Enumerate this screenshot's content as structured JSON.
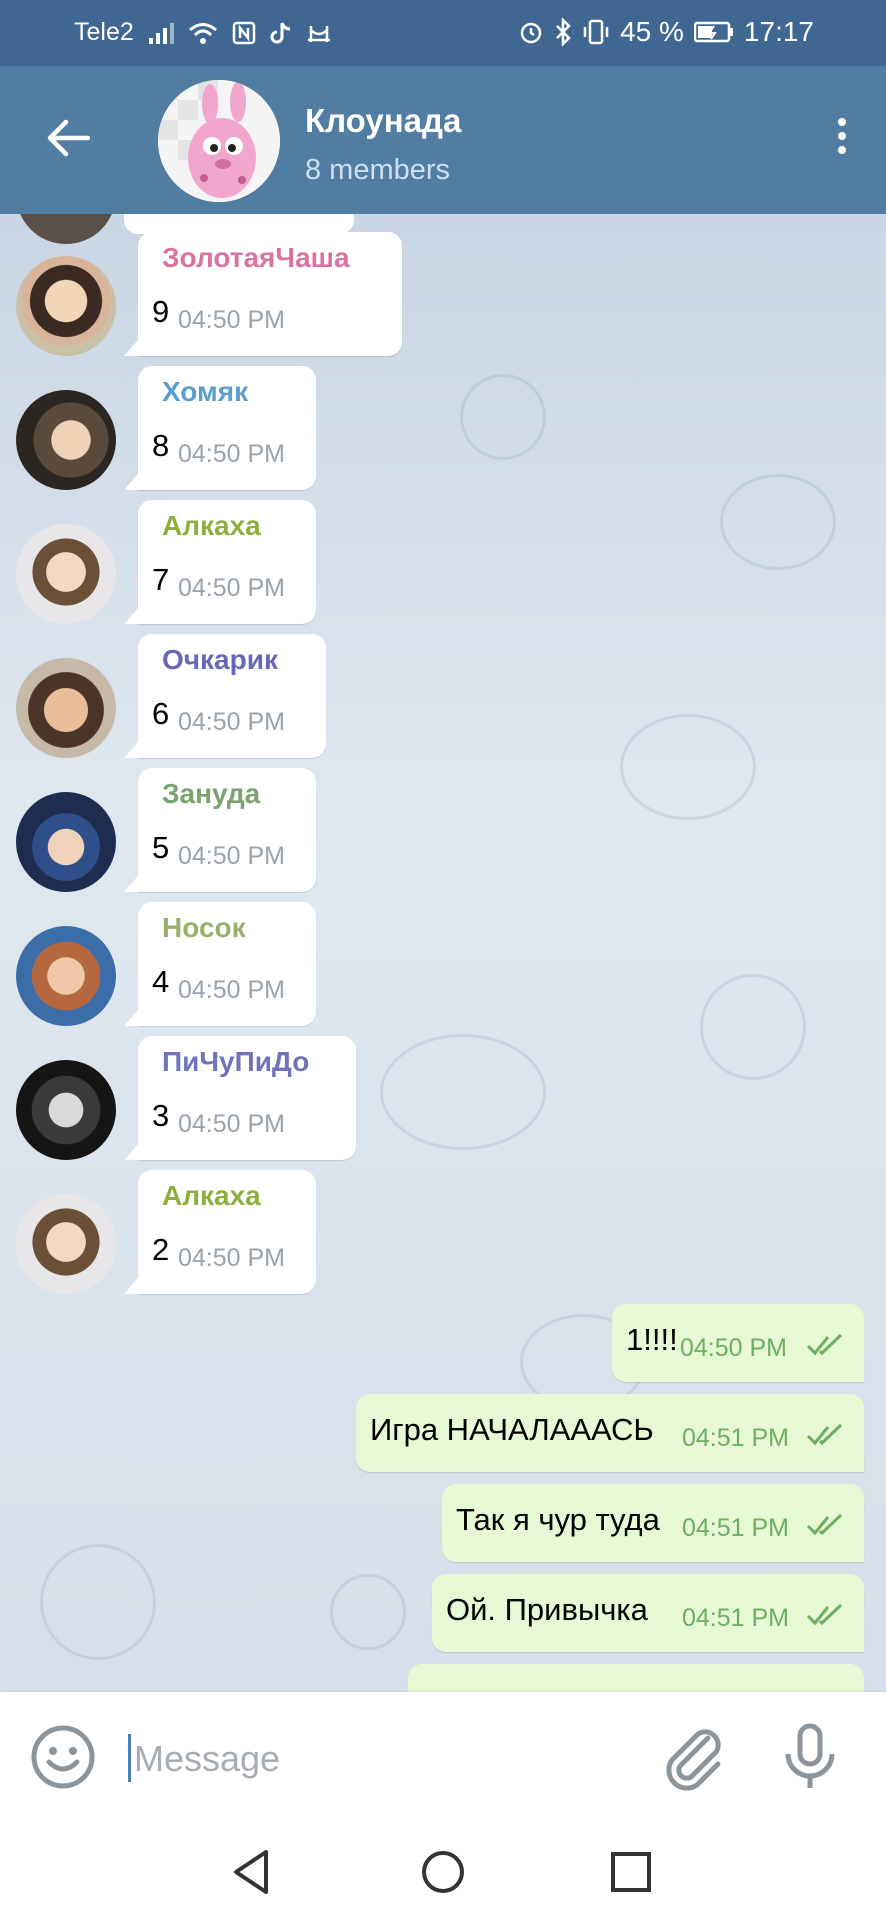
{
  "status_bar": {
    "carrier": "Tele2",
    "battery": "45 %",
    "time": "17:17"
  },
  "header": {
    "title": "Клоунада",
    "subtitle": "8 members"
  },
  "messages_in": [
    {
      "sender": "ЗолотаяЧаша",
      "sender_color": "#d9739f",
      "text": "9",
      "time": "04:50 PM"
    },
    {
      "sender": "Хомяк",
      "sender_color": "#5a9fce",
      "text": "8",
      "time": "04:50 PM"
    },
    {
      "sender": "Алкаха",
      "sender_color": "#8eae3e",
      "text": "7",
      "time": "04:50 PM"
    },
    {
      "sender": "Очкарик",
      "sender_color": "#6a67b5",
      "text": "6",
      "time": "04:50 PM"
    },
    {
      "sender": "Зануда",
      "sender_color": "#7aa36f",
      "text": "5",
      "time": "04:50 PM"
    },
    {
      "sender": "Носок",
      "sender_color": "#9cae6b",
      "text": "4",
      "time": "04:50 PM"
    },
    {
      "sender": "ПиЧуПиДо",
      "sender_color": "#6f73b8",
      "text": "3",
      "time": "04:50 PM"
    },
    {
      "sender": "Алкаха",
      "sender_color": "#8eae3e",
      "text": "2",
      "time": "04:50 PM"
    }
  ],
  "messages_out": [
    {
      "text": "1!!!!",
      "time": "04:50 PM"
    },
    {
      "text": "Игра НАЧАЛАААСЬ",
      "time": "04:51 PM"
    },
    {
      "text": "Так я чур туда",
      "time": "04:51 PM"
    },
    {
      "text": "Ой. Привычка",
      "time": "04:51 PM"
    }
  ],
  "input": {
    "placeholder": "Message"
  },
  "colors": {
    "header": "#517da2",
    "statusbar": "#3f6792",
    "bubble_out": "#e6f9d4",
    "check": "#6dae62"
  }
}
